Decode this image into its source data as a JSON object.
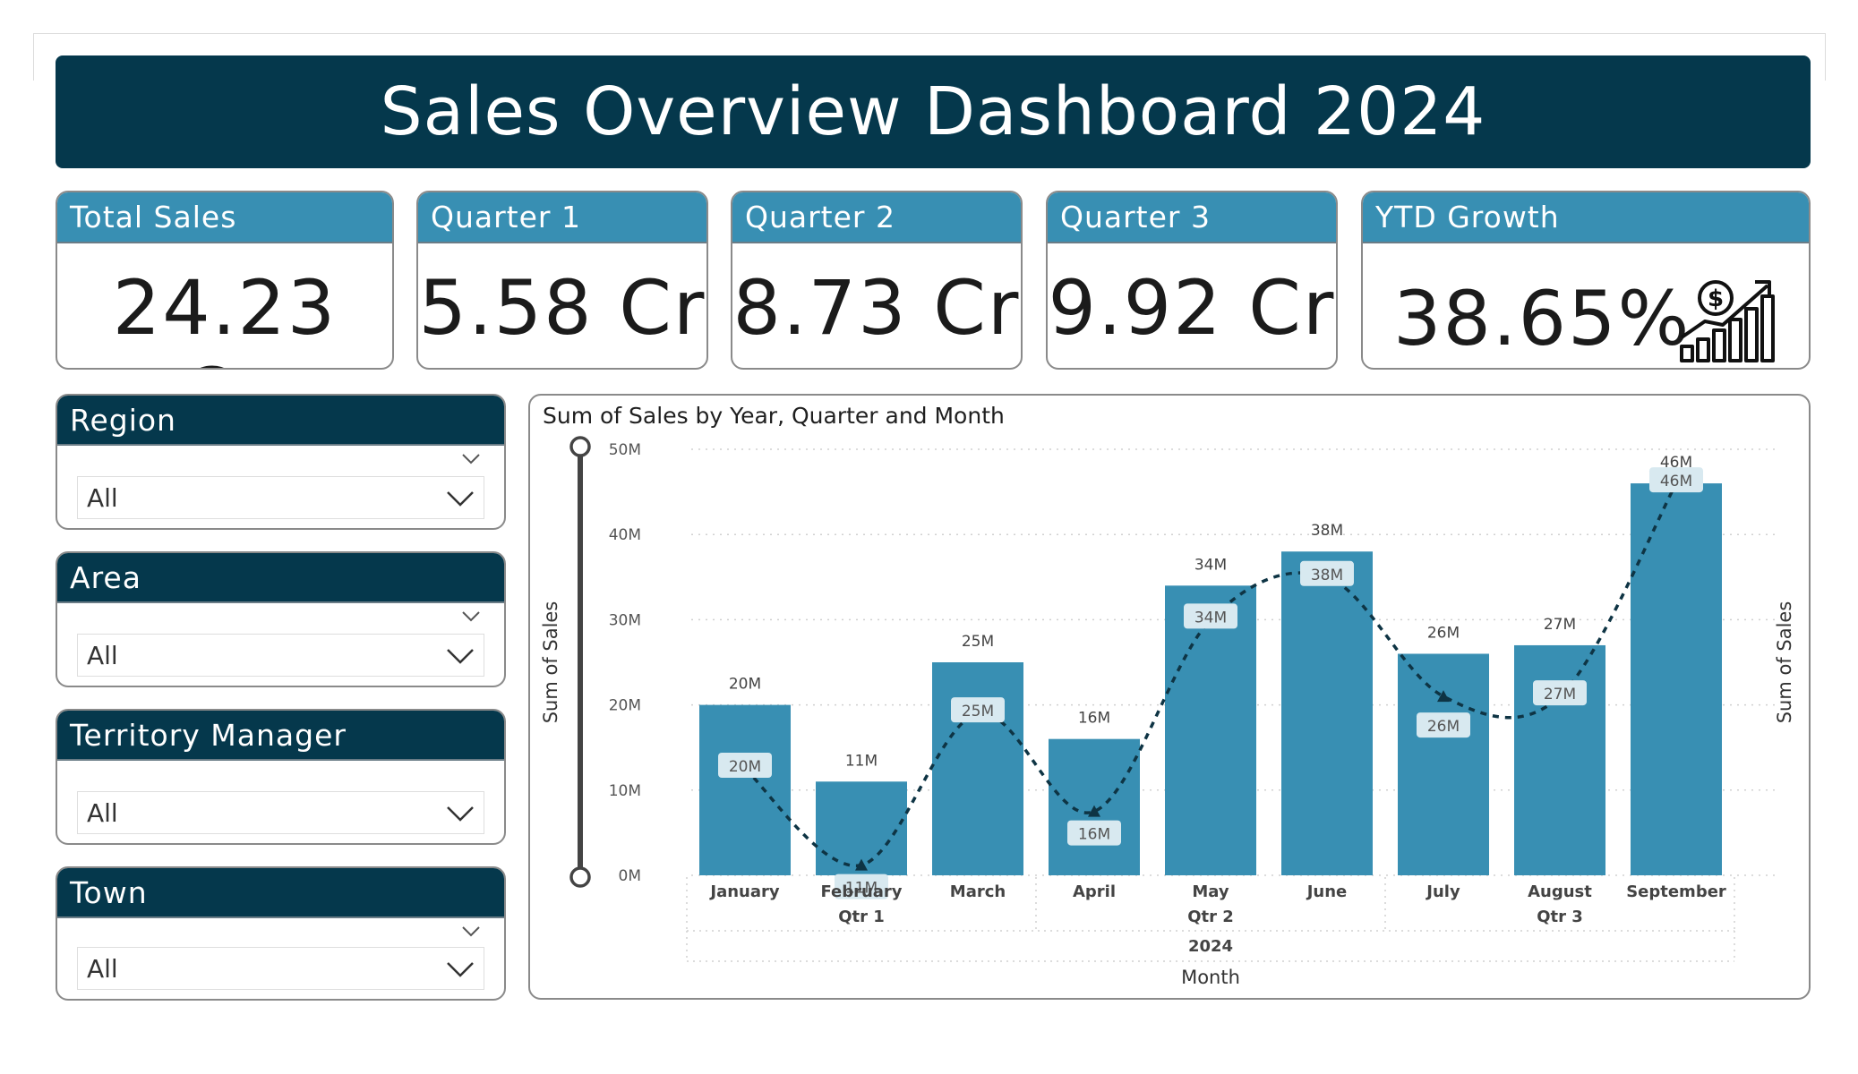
{
  "dashboard": {
    "title": "Sales Overview Dashboard 2024"
  },
  "kpis": [
    {
      "label": "Total Sales",
      "value": "24.23 Cr"
    },
    {
      "label": "Quarter 1",
      "value": "5.58 Cr"
    },
    {
      "label": "Quarter 2",
      "value": "8.73 Cr"
    },
    {
      "label": "Quarter 3",
      "value": "9.92 Cr"
    },
    {
      "label": "YTD Growth",
      "value": "38.65%",
      "icon": "growth-chart-dollar-icon"
    }
  ],
  "slicers": [
    {
      "label": "Region",
      "value": "All"
    },
    {
      "label": "Area",
      "value": "All"
    },
    {
      "label": "Territory Manager",
      "value": "All"
    },
    {
      "label": "Town",
      "value": "All"
    }
  ],
  "colors": {
    "title_bg": "#05384c",
    "kpi_head": "#388fb3",
    "bar": "#388fb3",
    "line": "#0e3444"
  },
  "chart_data": {
    "type": "bar",
    "title": "Sum of Sales by Year, Quarter and Month",
    "xlabel": "Month",
    "ylabel": "Sum of Sales",
    "ylabel_secondary": "Sum of Sales",
    "ylim": [
      0,
      50
    ],
    "yticks": [
      "0M",
      "10M",
      "20M",
      "30M",
      "40M",
      "50M"
    ],
    "categories": [
      "January",
      "February",
      "March",
      "April",
      "May",
      "June",
      "July",
      "August",
      "September"
    ],
    "quarters": [
      {
        "label": "Qtr 1",
        "months": [
          "January",
          "February",
          "March"
        ]
      },
      {
        "label": "Qtr 2",
        "months": [
          "April",
          "May",
          "June"
        ]
      },
      {
        "label": "Qtr 3",
        "months": [
          "July",
          "August",
          "September"
        ]
      }
    ],
    "year": "2024",
    "values": [
      20,
      11,
      25,
      16,
      34,
      38,
      26,
      27,
      46
    ],
    "value_labels": [
      "20M",
      "11M",
      "25M",
      "16M",
      "34M",
      "38M",
      "26M",
      "27M",
      "46M"
    ],
    "line_values": [
      12.5,
      1.2,
      19,
      7.5,
      30,
      35,
      21,
      21,
      46
    ],
    "grid": true
  }
}
